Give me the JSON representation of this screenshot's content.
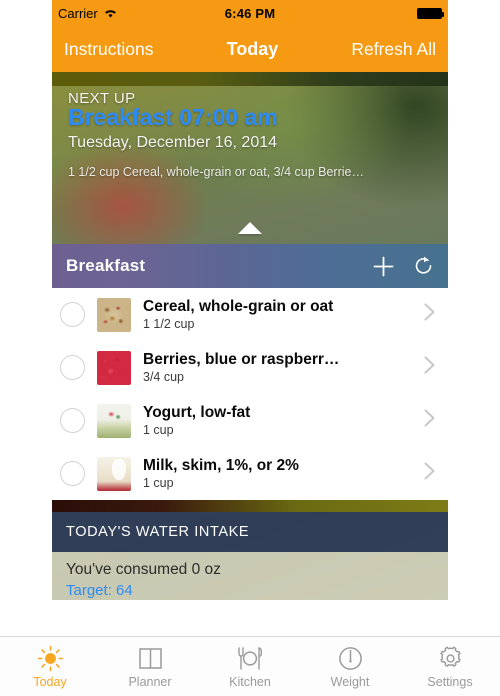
{
  "status_bar": {
    "carrier": "Carrier",
    "wifi_icon": "wifi-icon",
    "time": "6:46 PM",
    "battery_icon": "battery-full-icon"
  },
  "nav_bar": {
    "left_button": "Instructions",
    "title": "Today",
    "right_button": "Refresh All"
  },
  "hero": {
    "eyebrow": "NEXT UP",
    "title": "Breakfast 07:00 am",
    "date": "Tuesday, December 16, 2014",
    "items_summary": "1 1/2  cup Cereal, whole-grain or oat, 3/4  cup Berrie…",
    "expand_icon": "caret-up-icon",
    "title_color": "#2D8BF5"
  },
  "meal_section": {
    "title": "Breakfast",
    "add_icon": "plus-icon",
    "refresh_icon": "refresh-icon",
    "items": [
      {
        "name": "Cereal, whole-grain or oat",
        "quantity": "1 1/2  cup",
        "thumb": "cereal-thumbnail",
        "checkbox": "unchecked",
        "chevron": "chevron-right-icon"
      },
      {
        "name": "Berries, blue or raspberr…",
        "quantity": "3/4 cup",
        "thumb": "berries-thumbnail",
        "checkbox": "unchecked",
        "chevron": "chevron-right-icon"
      },
      {
        "name": "Yogurt, low-fat",
        "quantity": "1 cup",
        "thumb": "yogurt-thumbnail",
        "checkbox": "unchecked",
        "chevron": "chevron-right-icon"
      },
      {
        "name": "Milk, skim, 1%, or 2%",
        "quantity": "1 cup",
        "thumb": "milk-thumbnail",
        "checkbox": "unchecked",
        "chevron": "chevron-right-icon"
      }
    ]
  },
  "water_card": {
    "header": "TODAY'S WATER INTAKE",
    "consumed": "You've consumed 0 oz",
    "target": "Target: 64"
  },
  "tab_bar": {
    "active_color": "#F5A623",
    "inactive_color": "#9a9a9a",
    "tabs": [
      {
        "label": "Today",
        "icon": "sun-icon",
        "active": true
      },
      {
        "label": "Planner",
        "icon": "book-icon",
        "active": false
      },
      {
        "label": "Kitchen",
        "icon": "utensils-plate-icon",
        "active": false
      },
      {
        "label": "Weight",
        "icon": "scale-dial-icon",
        "active": false
      },
      {
        "label": "Settings",
        "icon": "gear-icon",
        "active": false
      }
    ]
  }
}
